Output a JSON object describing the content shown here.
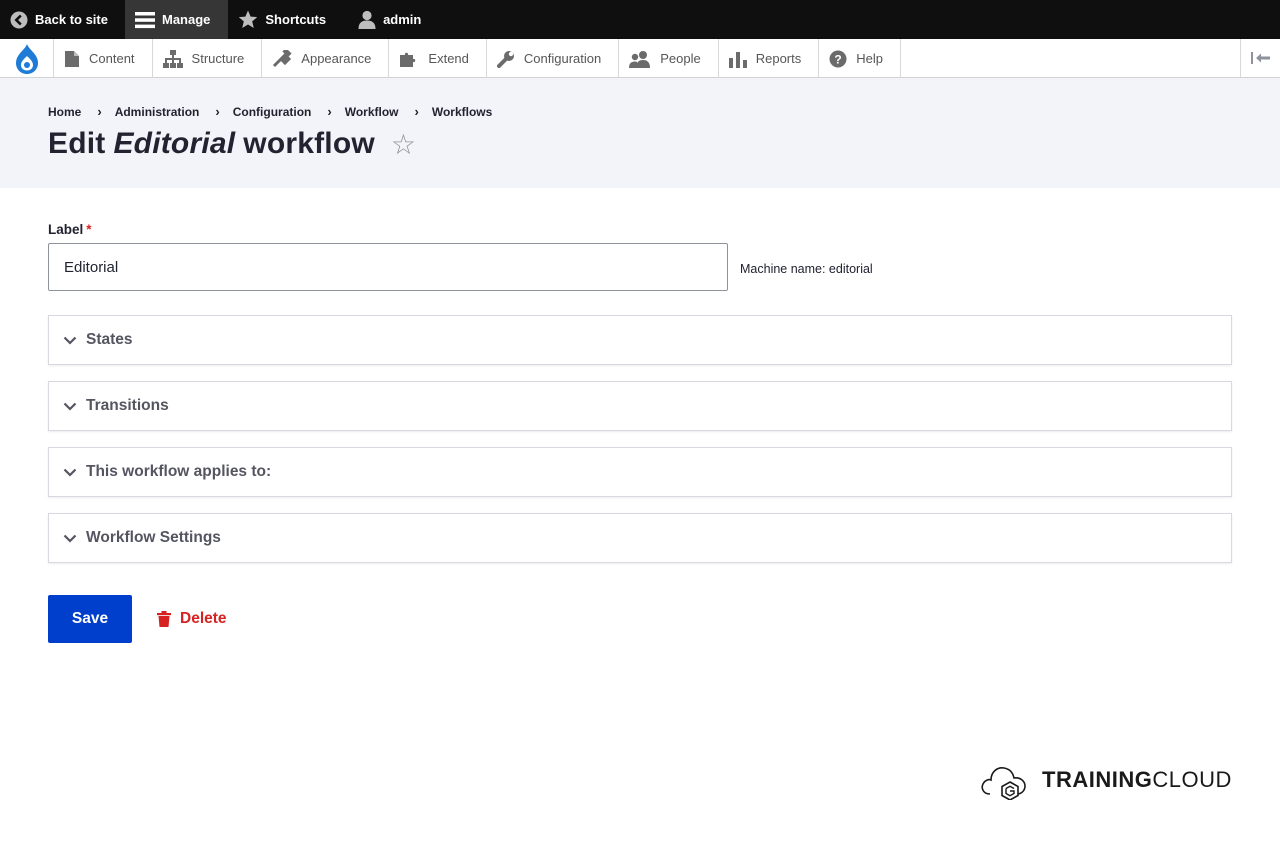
{
  "toolbar": {
    "back_label": "Back to site",
    "manage_label": "Manage",
    "shortcuts_label": "Shortcuts",
    "user_label": "admin"
  },
  "tray": {
    "items": [
      "Content",
      "Structure",
      "Appearance",
      "Extend",
      "Configuration",
      "People",
      "Reports",
      "Help"
    ]
  },
  "breadcrumb": [
    "Home",
    "Administration",
    "Configuration",
    "Workflow",
    "Workflows"
  ],
  "title": {
    "prefix": "Edit",
    "name": "Editorial",
    "suffix": "workflow",
    "star": "☆"
  },
  "form": {
    "label_text": "Label",
    "required_mark": "*",
    "label_value": "Editorial",
    "machine_name": "Machine name: editorial",
    "sections": [
      "States",
      "Transitions",
      "This workflow applies to:",
      "Workflow Settings"
    ],
    "save_label": "Save",
    "delete_label": "Delete"
  },
  "brand": {
    "bold": "TRAINING",
    "light": "CLOUD"
  },
  "colors": {
    "toolbar_bg": "#0f0f0f",
    "accent_blue": "#003ecc",
    "danger_red": "#d72222",
    "header_bg": "#f3f4f9"
  }
}
